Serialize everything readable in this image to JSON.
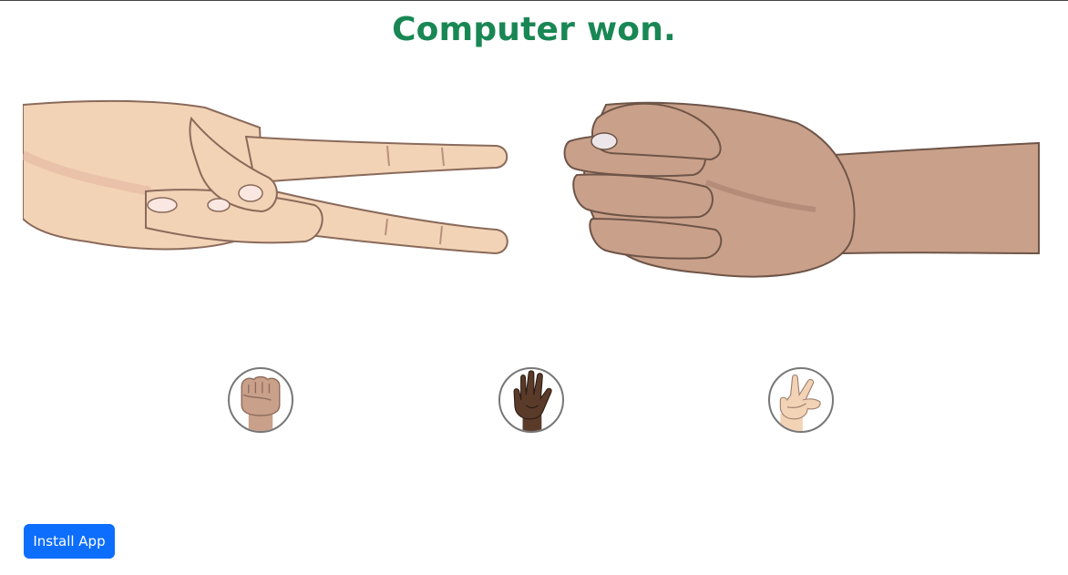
{
  "result": {
    "text": "Computer won."
  },
  "board": {
    "player_choice_icon": "scissors-hand-icon",
    "computer_choice_icon": "rock-fist-icon"
  },
  "choices": [
    {
      "icon": "rock-fist-icon"
    },
    {
      "icon": "paper-hand-icon"
    },
    {
      "icon": "scissors-hand-icon"
    }
  ],
  "install": {
    "label": "Install App"
  },
  "colors": {
    "result_text": "#198754",
    "button_bg": "#0d6efd",
    "light_skin": "#f3d3b6",
    "medium_skin": "#c9a08a",
    "dark_skin": "#5a3b2a"
  }
}
